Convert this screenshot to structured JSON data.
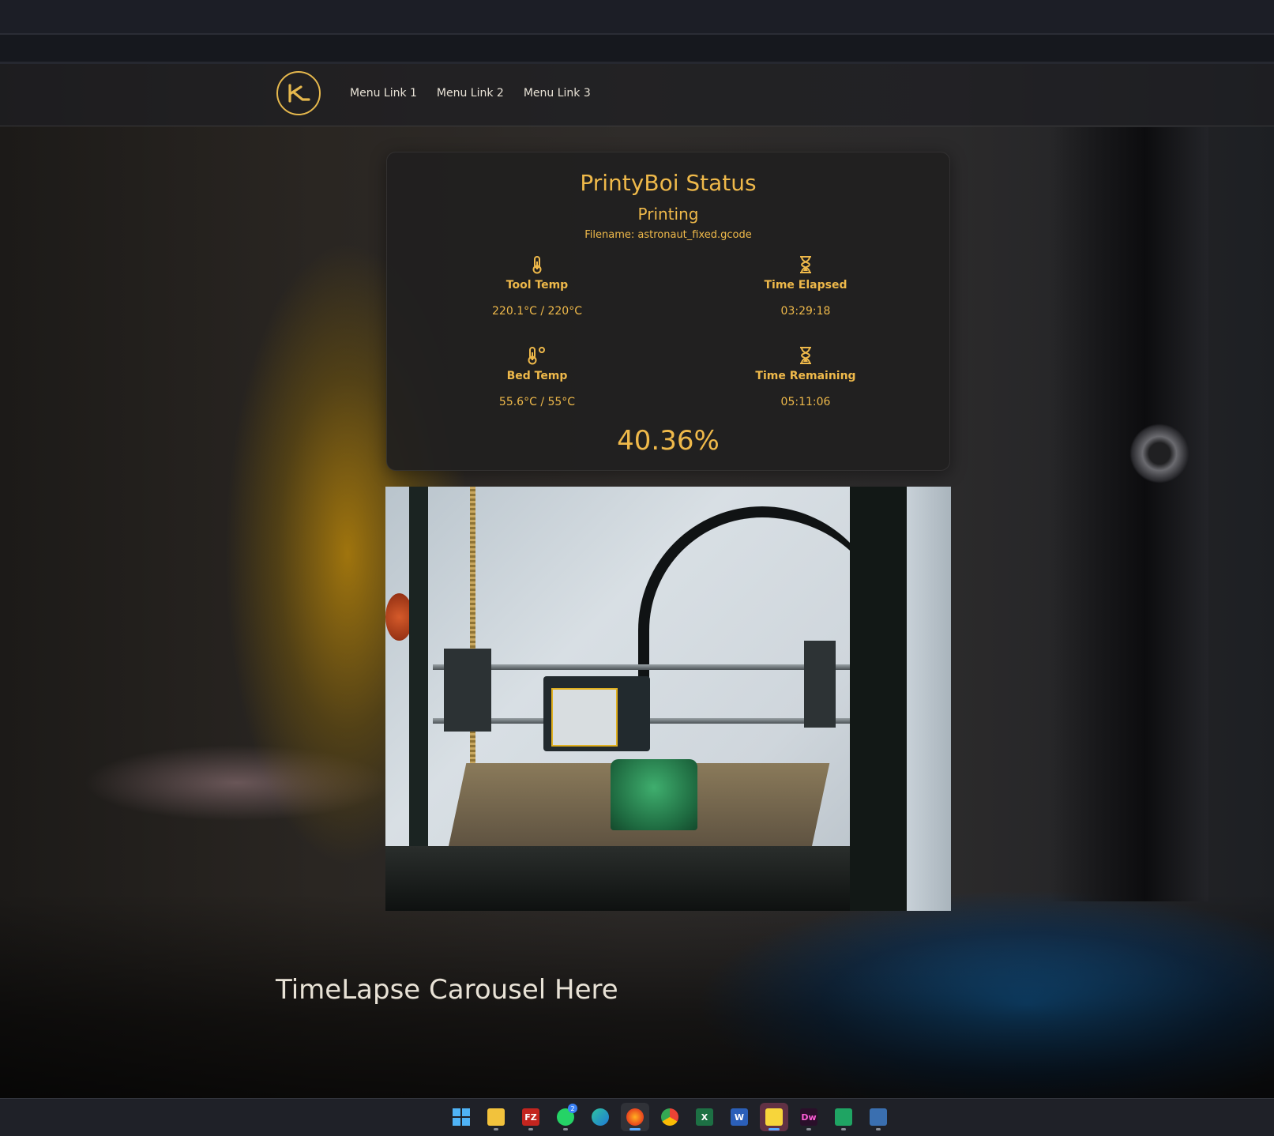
{
  "nav": {
    "links": [
      "Menu Link 1",
      "Menu Link 2",
      "Menu Link 3"
    ]
  },
  "status": {
    "title": "PrintyBoi Status",
    "state": "Printing",
    "filename": "Filename: astronaut_fixed.gcode",
    "tool_temp": {
      "label": "Tool Temp",
      "value": "220.1°C / 220°C",
      "icon": "thermometer-icon"
    },
    "time_elapsed": {
      "label": "Time Elapsed",
      "value": "03:29:18",
      "icon": "hourglass-icon"
    },
    "bed_temp": {
      "label": "Bed Temp",
      "value": "55.6°C / 55°C",
      "icon": "bed-thermometer-icon"
    },
    "time_remaining": {
      "label": "Time Remaining",
      "value": "05:11:06",
      "icon": "hourglass-icon"
    },
    "progress": "40.36%"
  },
  "timelapse": {
    "placeholder": "TimeLapse Carousel Here"
  },
  "taskbar": {
    "whatsapp_badge": "2",
    "apps": [
      "start",
      "file-explorer",
      "filezilla",
      "whatsapp",
      "edge",
      "firefox",
      "chrome",
      "excel",
      "word",
      "sticky-notes",
      "dreamweaver",
      "sheets",
      "network"
    ]
  },
  "colors": {
    "accent": "#efb94a",
    "text_light": "#e8e2d6",
    "card_bg": "#201f1f"
  }
}
